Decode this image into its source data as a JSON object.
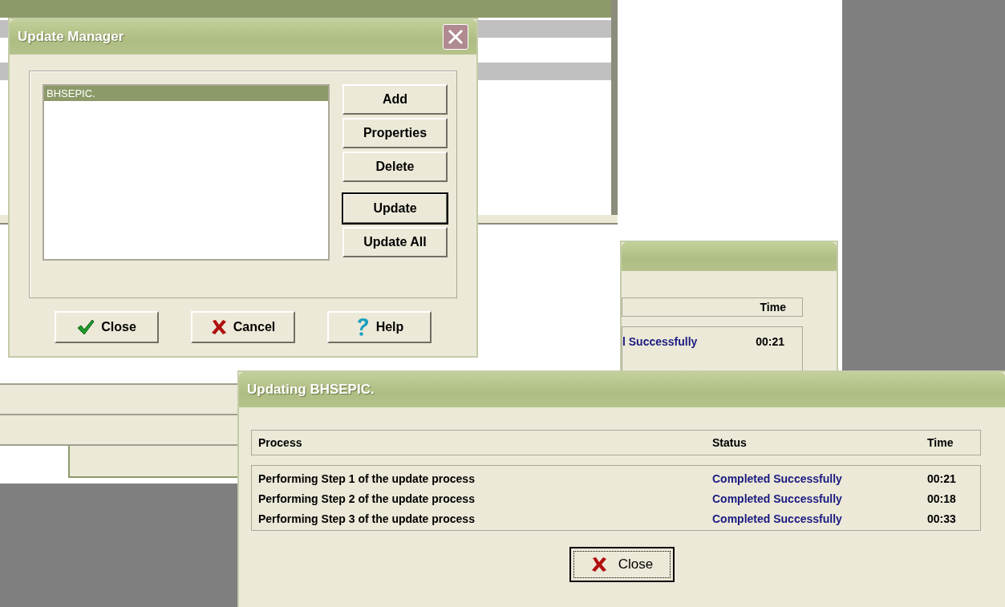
{
  "back_window": {
    "column_header": "Time",
    "row": {
      "status": "l Successfully",
      "time": "00:21"
    }
  },
  "update_manager": {
    "title": "Update Manager",
    "list_items": [
      {
        "label": "BHSEPIC.",
        "selected": true
      }
    ],
    "side_buttons": [
      {
        "label": "Add",
        "default": false
      },
      {
        "label": "Properties",
        "default": false
      },
      {
        "label": "Delete",
        "default": false
      },
      {
        "label": "Update",
        "default": true
      },
      {
        "label": "Update All",
        "default": false
      }
    ],
    "bottom_buttons": [
      {
        "label": "Close",
        "kind": "check"
      },
      {
        "label": "Cancel",
        "kind": "cross"
      },
      {
        "label": "Help",
        "kind": "question"
      }
    ]
  },
  "updating_dialog": {
    "title": "Updating BHSEPIC.",
    "columns": [
      "Process",
      "Status",
      "Time"
    ],
    "rows": [
      {
        "process": "Performing Step 1 of the update process",
        "status": "Completed Successfully",
        "time": "00:21"
      },
      {
        "process": "Performing Step 2 of the update process",
        "status": "Completed Successfully",
        "time": "00:18"
      },
      {
        "process": "Performing Step 3 of the update process",
        "status": "Completed Successfully",
        "time": "00:33"
      }
    ],
    "button": {
      "label": "Close",
      "kind": "cross"
    }
  }
}
